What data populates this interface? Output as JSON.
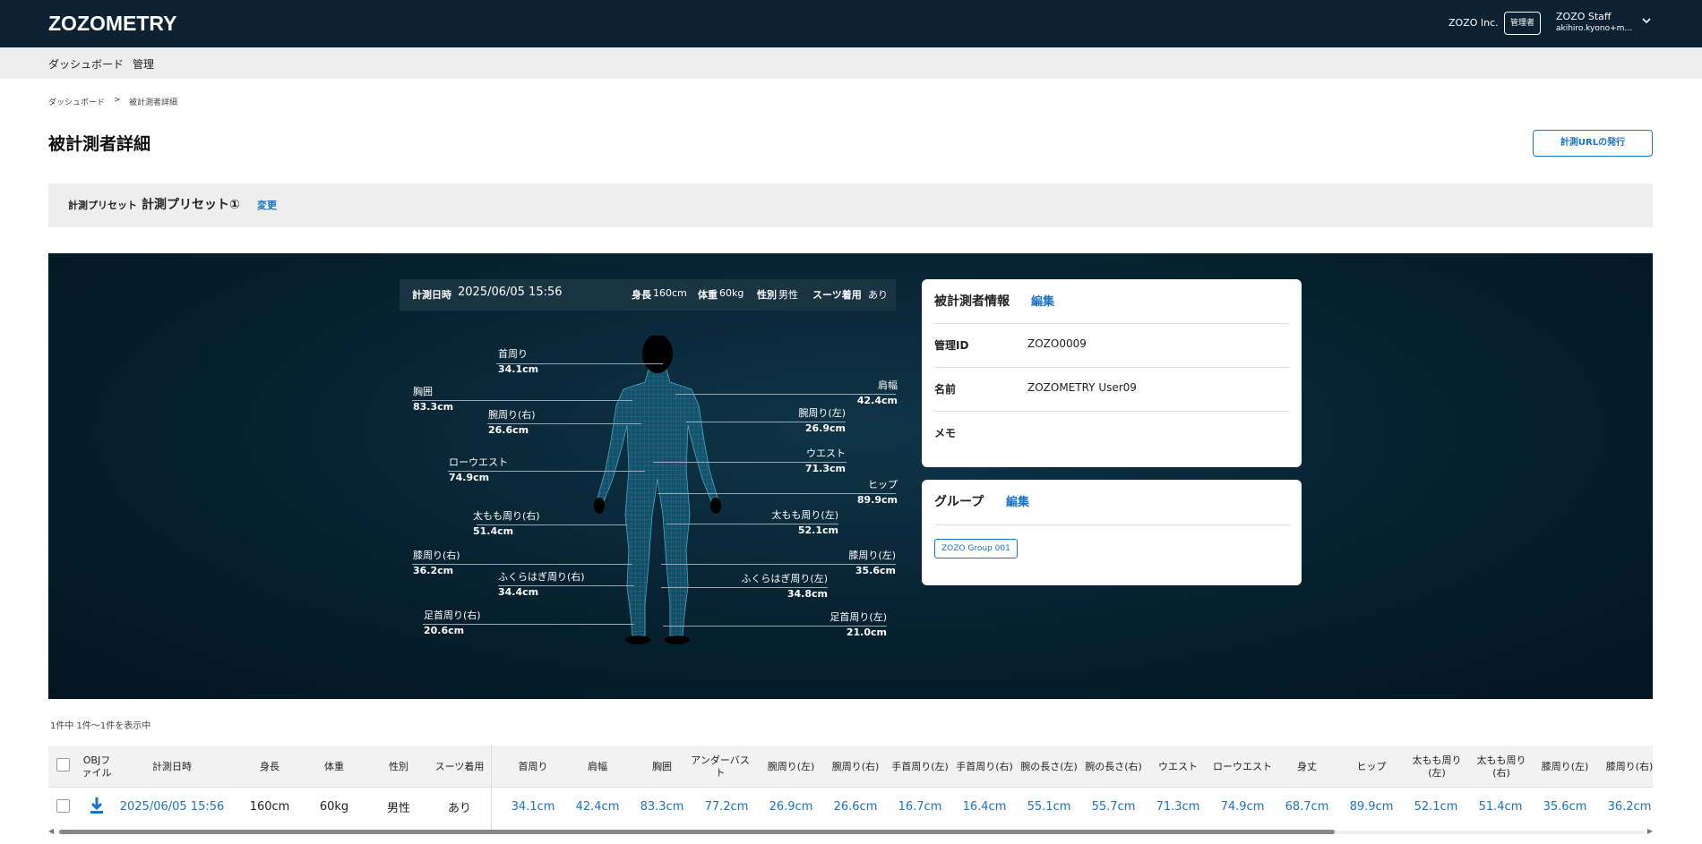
{
  "header": {
    "logo": "ZOZOMETRY",
    "org": "ZOZO Inc.",
    "role_badge": "管理者",
    "user_name": "ZOZO Staff",
    "user_email": "akihiro.kyono+m…"
  },
  "nav": {
    "items": [
      "ダッシュボード",
      "管理"
    ]
  },
  "breadcrumb": {
    "items": [
      "ダッシュボード",
      "被計測者詳細"
    ],
    "separator": ">"
  },
  "page": {
    "title": "被計測者詳細",
    "issue_url_button": "計測URLの発行"
  },
  "preset": {
    "label": "計測プリセット",
    "value": "計測プリセット①",
    "change_link": "変更"
  },
  "measurement": {
    "date_label": "計測日時",
    "date_value": "2025/06/05 15:56",
    "height_label": "身長",
    "height_value": "160cm",
    "weight_label": "体重",
    "weight_value": "60kg",
    "gender_label": "性別",
    "gender_value": "男性",
    "suit_label": "スーツ着用",
    "suit_value": "あり",
    "body_labels": {
      "neck": {
        "name": "首周り",
        "value": "34.1cm"
      },
      "chest": {
        "name": "胸囲",
        "value": "83.3cm"
      },
      "shoulder": {
        "name": "肩幅",
        "value": "42.4cm"
      },
      "arm_r": {
        "name": "腕周り(右)",
        "value": "26.6cm"
      },
      "arm_l": {
        "name": "腕周り(左)",
        "value": "26.9cm"
      },
      "waist": {
        "name": "ウエスト",
        "value": "71.3cm"
      },
      "low_waist": {
        "name": "ローウエスト",
        "value": "74.9cm"
      },
      "hip": {
        "name": "ヒップ",
        "value": "89.9cm"
      },
      "thigh_r": {
        "name": "太もも周り(右)",
        "value": "51.4cm"
      },
      "thigh_l": {
        "name": "太もも周り(左)",
        "value": "52.1cm"
      },
      "knee_r": {
        "name": "膝周り(右)",
        "value": "36.2cm"
      },
      "knee_l": {
        "name": "膝周り(左)",
        "value": "35.6cm"
      },
      "calf_r": {
        "name": "ふくらはぎ周り(右)",
        "value": "34.4cm"
      },
      "calf_l": {
        "name": "ふくらはぎ周り(左)",
        "value": "34.8cm"
      },
      "ankle_r": {
        "name": "足首周り(右)",
        "value": "20.6cm"
      },
      "ankle_l": {
        "name": "足首周り(左)",
        "value": "21.0cm"
      }
    }
  },
  "subject_info": {
    "title": "被計測者情報",
    "edit": "編集",
    "id_label": "管理ID",
    "id_value": "ZOZO0009",
    "name_label": "名前",
    "name_value": "ZOZOMETRY User09",
    "memo_label": "メモ",
    "memo_value": ""
  },
  "group": {
    "title": "グループ",
    "edit": "編集",
    "tag": "ZOZO Group 001"
  },
  "table": {
    "count_text": "1件中 1件～1件を表示中",
    "headers": [
      "OBJファイル",
      "計測日時",
      "身長",
      "体重",
      "性別",
      "スーツ着用",
      "首周り",
      "肩幅",
      "胸囲",
      "アンダーバスト",
      "腕周り(左)",
      "腕周り(右)",
      "手首周り(左)",
      "手首周り(右)",
      "腕の長さ(左)",
      "腕の長さ(右)",
      "ウエスト",
      "ローウエスト",
      "身丈",
      "ヒップ",
      "太もも周り(左)",
      "太もも周り(右)",
      "膝周り(左)",
      "膝周り(右)"
    ],
    "row": [
      "2025/06/05 15:56",
      "160cm",
      "60kg",
      "男性",
      "あり",
      "34.1cm",
      "42.4cm",
      "83.3cm",
      "77.2cm",
      "26.9cm",
      "26.6cm",
      "16.7cm",
      "16.4cm",
      "55.1cm",
      "55.7cm",
      "71.3cm",
      "74.9cm",
      "68.7cm",
      "89.9cm",
      "52.1cm",
      "51.4cm",
      "35.6cm",
      "36.2cm"
    ]
  },
  "colors": {
    "header_bg": "#0c2233",
    "accent": "#1a73c7",
    "viz_bg": "#06202f"
  }
}
